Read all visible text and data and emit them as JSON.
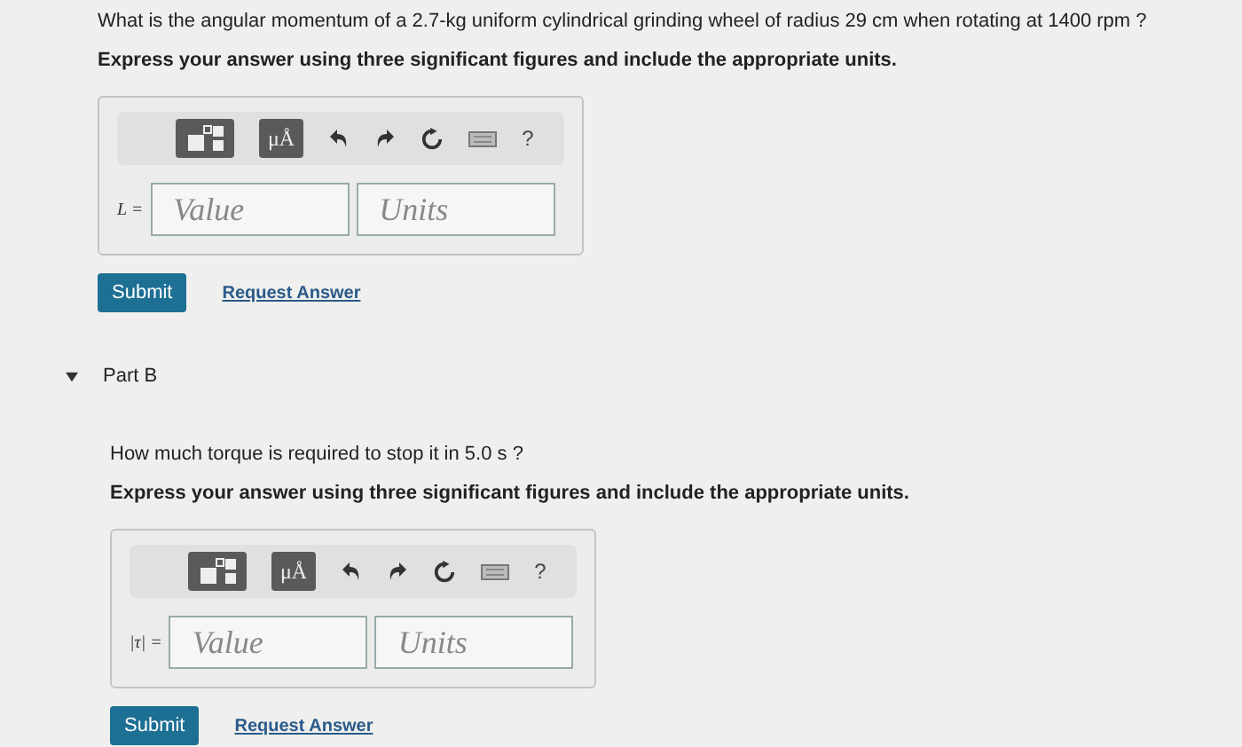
{
  "parts": [
    {
      "question": "What is the angular momentum of a 2.7-kg uniform cylindrical grinding wheel of radius 29 cm when rotating at 1400 rpm ?",
      "instruction": "Express your answer using three significant figures and include the appropriate units.",
      "toolbar": {
        "symbols": "μÅ",
        "help": "?"
      },
      "answer_label": "L =",
      "value_placeholder": "Value",
      "units_placeholder": "Units",
      "submit": "Submit",
      "request_answer": "Request Answer"
    },
    {
      "title": "Part B",
      "expanded": true,
      "question": "How much torque is required to stop it in 5.0 s ?",
      "instruction": "Express your answer using three significant figures and include the appropriate units.",
      "toolbar": {
        "symbols": "μÅ",
        "help": "?"
      },
      "answer_label": "|τ| =",
      "value_placeholder": "Value",
      "units_placeholder": "Units",
      "submit": "Submit",
      "request_answer": "Request Answer"
    }
  ]
}
